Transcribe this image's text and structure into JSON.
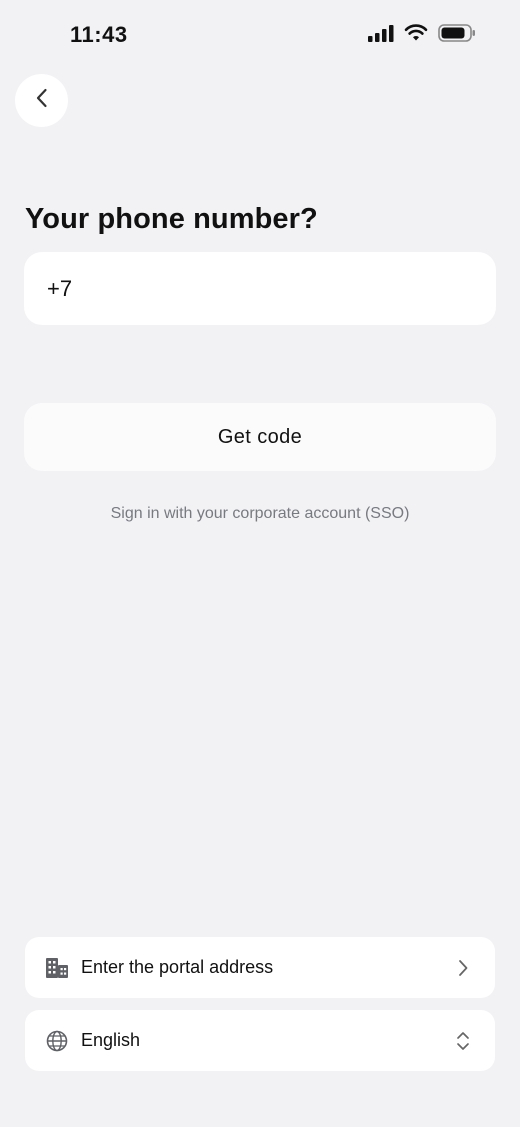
{
  "status_bar": {
    "time": "11:43",
    "icons": [
      "cellular-signal-icon",
      "wifi-icon",
      "battery-icon"
    ]
  },
  "header": {
    "back_icon": "chevron-left-icon"
  },
  "main": {
    "title": "Your phone number?",
    "phone_input": {
      "value": "+7",
      "placeholder": ""
    },
    "get_code_label": "Get code",
    "sso_label": "Sign in with your corporate account (SSO)"
  },
  "options": {
    "portal": {
      "label": "Enter the portal address",
      "icon": "building-icon",
      "trailing_icon": "chevron-right-icon"
    },
    "language": {
      "label": "English",
      "icon": "globe-icon",
      "trailing_icon": "chevron-up-down-icon"
    }
  },
  "colors": {
    "background": "#f2f2f5",
    "card": "#ffffff",
    "text_primary": "#111111",
    "text_secondary": "#777a80"
  }
}
